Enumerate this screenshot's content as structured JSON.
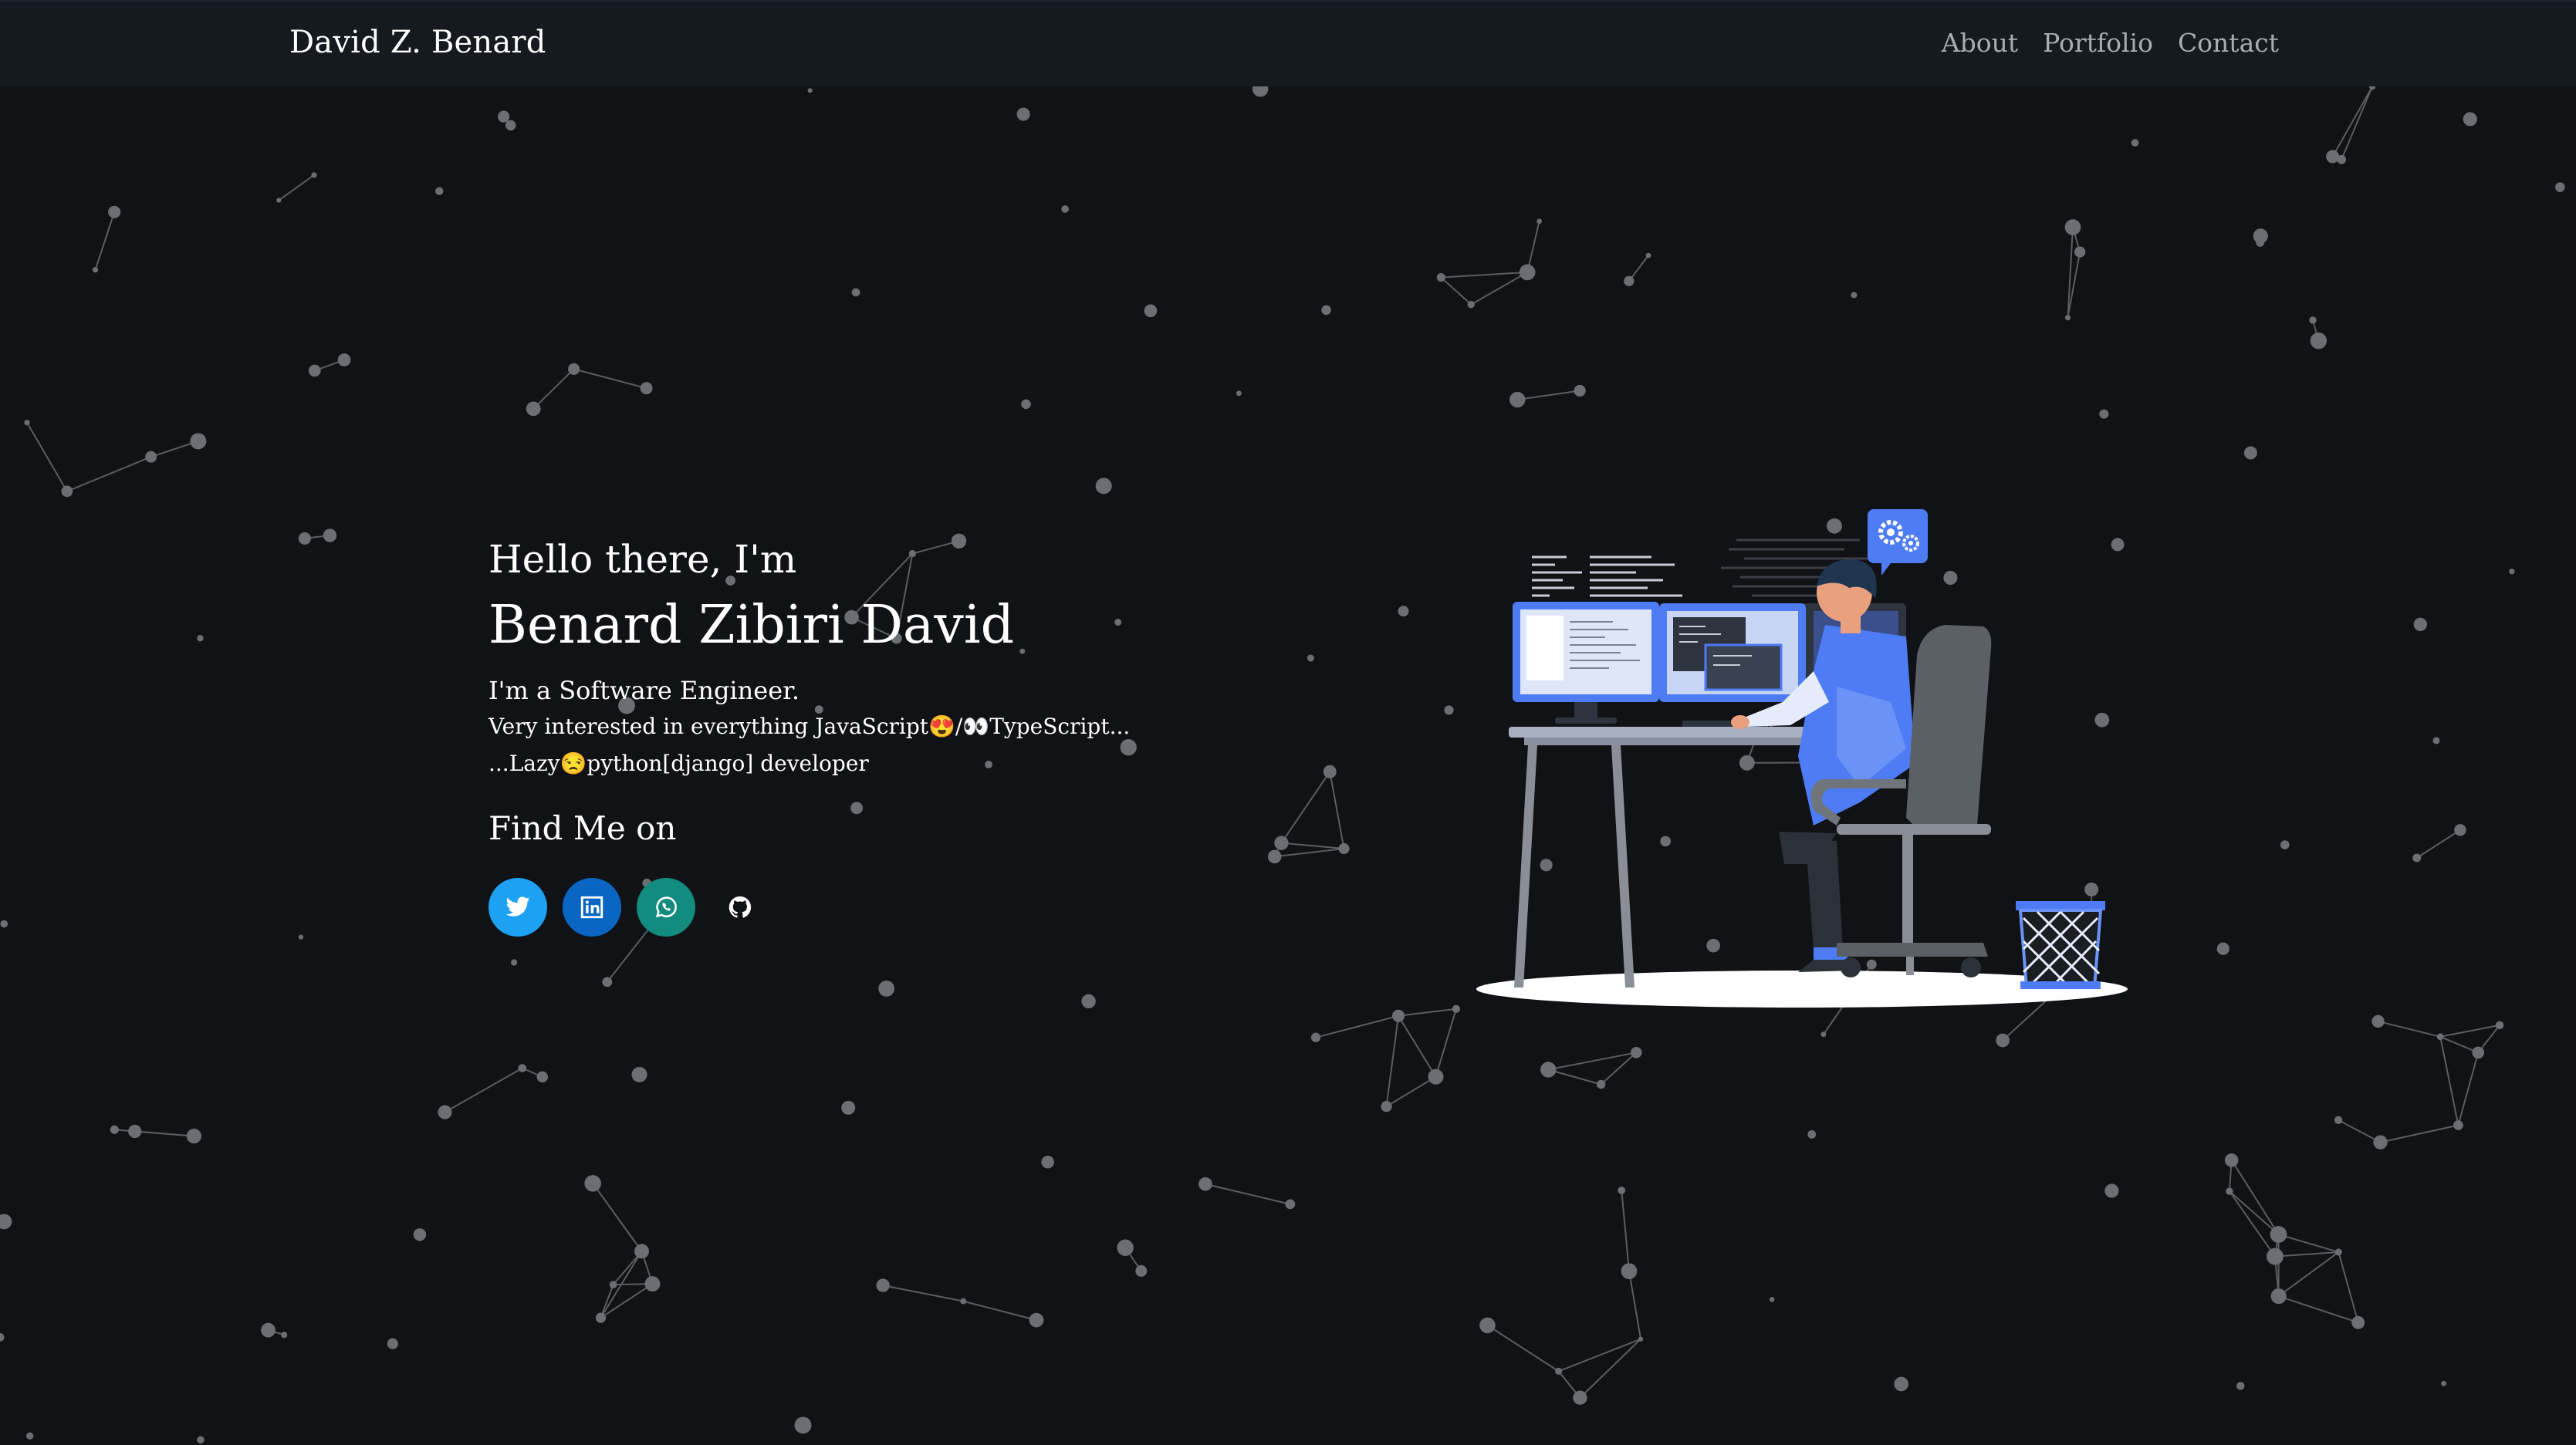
{
  "navbar": {
    "brand": "David Z. Benard",
    "links": [
      "About",
      "Portfolio",
      "Contact"
    ]
  },
  "hero": {
    "greeting": "Hello there, I'm",
    "name": "Benard Zibiri David",
    "tagline": "I'm a Software Engineer.",
    "line1": "Very interested in everything JavaScript😍/👀TypeScript...",
    "line2": "...Lazy😒python[django] developer",
    "find_title": "Find Me on"
  },
  "socials": [
    {
      "name": "twitter",
      "icon": "twitter-icon",
      "color": "#1da1f2"
    },
    {
      "name": "linkedin",
      "icon": "linkedin-icon",
      "color": "#0a66c2"
    },
    {
      "name": "whatsapp",
      "icon": "whatsapp-icon",
      "color": "#128c7e"
    },
    {
      "name": "github",
      "icon": "github-icon",
      "color": "#111215"
    }
  ],
  "colors": {
    "background": "#111215",
    "navbar": "#151a20",
    "accent": "#4d7cf5",
    "particle": "#6b6e73"
  }
}
